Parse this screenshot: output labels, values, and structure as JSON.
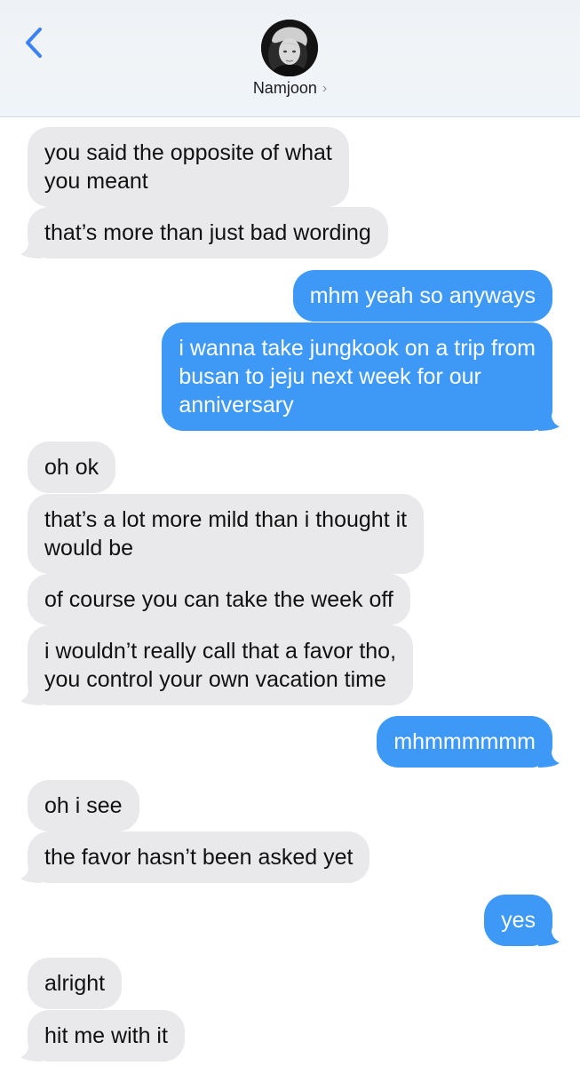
{
  "header": {
    "contact_name": "Namjoon",
    "back_icon": "chevron-left-icon",
    "chevron": "›"
  },
  "colors": {
    "incoming_bubble": "#e9e9eb",
    "outgoing_bubble": "#3d99f5",
    "accent": "#3a82f7"
  },
  "messages": [
    {
      "direction": "incoming",
      "lines": [
        "you said the opposite of what",
        "you meant"
      ]
    },
    {
      "direction": "incoming",
      "lines": [
        "that’s more than just bad wording"
      ]
    },
    {
      "direction": "outgoing",
      "lines": [
        "mhm yeah so anyways"
      ]
    },
    {
      "direction": "outgoing",
      "lines": [
        "i wanna take jungkook on a trip from",
        "busan to jeju next week for our",
        "anniversary"
      ]
    },
    {
      "direction": "incoming",
      "lines": [
        "oh ok"
      ]
    },
    {
      "direction": "incoming",
      "lines": [
        "that’s a lot more mild than i thought it",
        "would be"
      ]
    },
    {
      "direction": "incoming",
      "lines": [
        "of course you can take the week off"
      ]
    },
    {
      "direction": "incoming",
      "lines": [
        "i wouldn’t really call that a favor tho,",
        "you control your own vacation time"
      ]
    },
    {
      "direction": "outgoing",
      "lines": [
        "mhmmmmmm"
      ]
    },
    {
      "direction": "incoming",
      "lines": [
        "oh i see"
      ]
    },
    {
      "direction": "incoming",
      "lines": [
        "the favor hasn’t been asked yet"
      ]
    },
    {
      "direction": "outgoing",
      "lines": [
        "yes"
      ]
    },
    {
      "direction": "incoming",
      "lines": [
        "alright"
      ]
    },
    {
      "direction": "incoming",
      "lines": [
        "hit me with it"
      ]
    }
  ]
}
